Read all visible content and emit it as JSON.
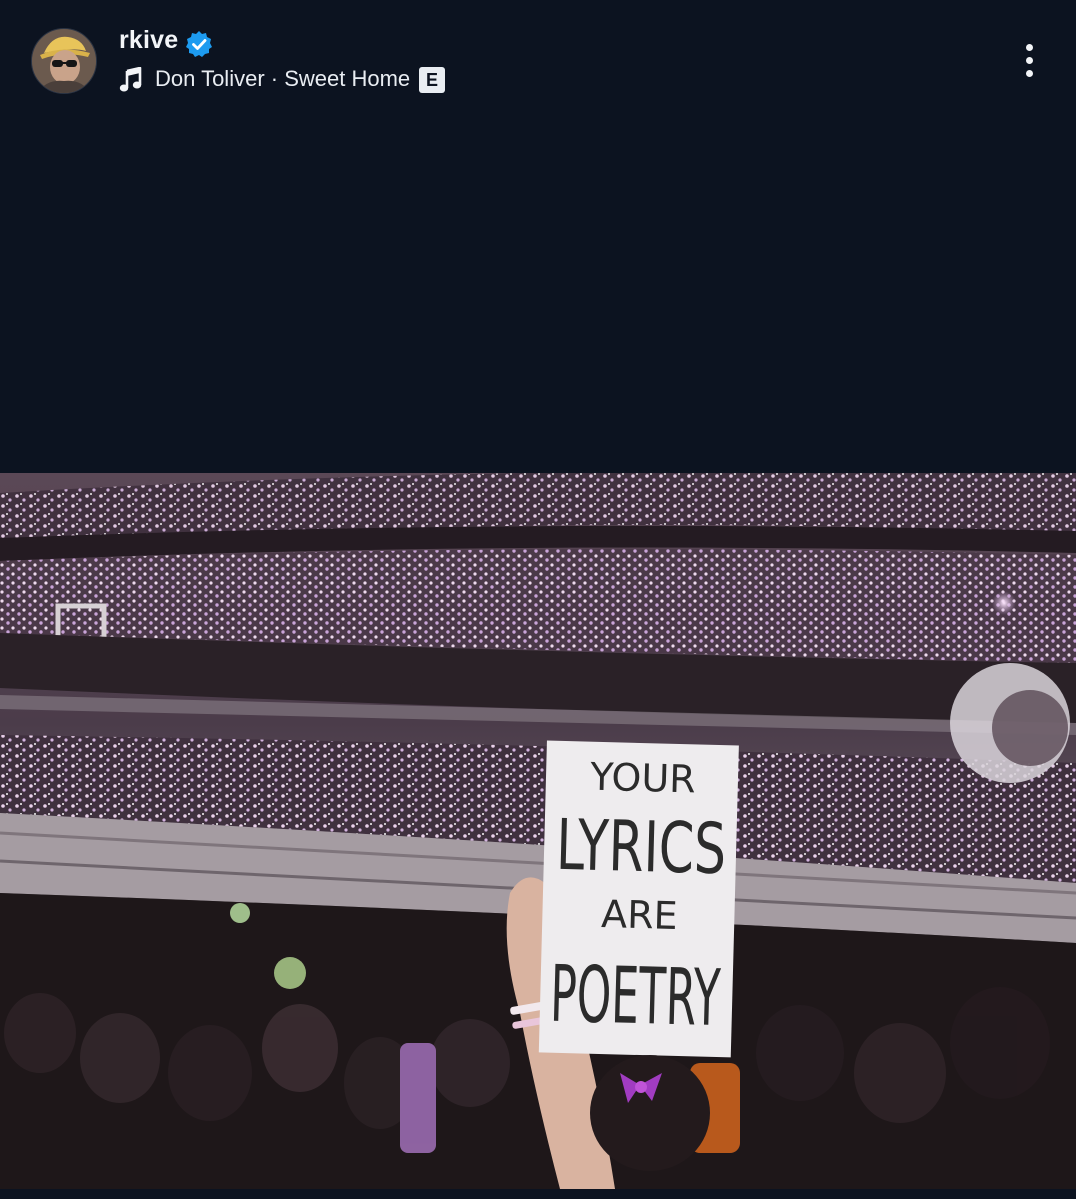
{
  "post": {
    "username": "rkive",
    "verified": true,
    "track": "Don Toliver · Sweet Home",
    "explicit_label": "E",
    "icons": {
      "avatar": "avatar",
      "verified": "verified-badge-icon",
      "music": "music-note-icon",
      "more": "more-vertical-icon"
    }
  },
  "photo": {
    "sign_lines": [
      "YOUR",
      "LYRICS",
      "ARE",
      "POETRY"
    ]
  },
  "colors": {
    "background": "#0c1320",
    "verified_blue": "#1d9bf0",
    "text": "#f3f5f8"
  }
}
